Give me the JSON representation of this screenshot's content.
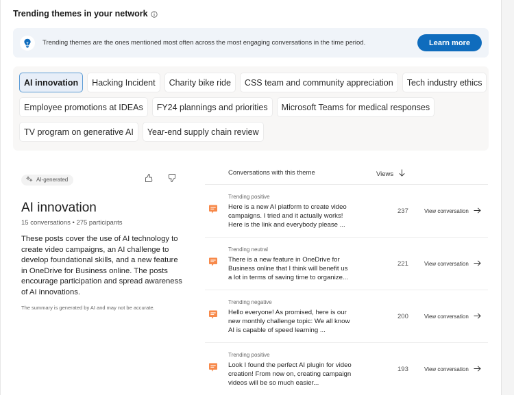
{
  "header": {
    "title": "Trending themes in your network",
    "info_icon": "info-icon"
  },
  "banner": {
    "icon": "lightbulb-icon",
    "text": "Trending themes are the ones mentioned most often across the most engaging conversations in the time period.",
    "button_label": "Learn more",
    "accent": "#0f6cbd"
  },
  "themes": {
    "rows": [
      [
        {
          "label": "AI innovation",
          "selected": true
        },
        {
          "label": "Hacking Incident"
        },
        {
          "label": "Charity bike ride"
        },
        {
          "label": "CSS team and community appreciation"
        },
        {
          "label": "Tech industry ethics"
        }
      ],
      [
        {
          "label": "Employee promotions at IDEAs"
        },
        {
          "label": "FY24 plannings and priorities"
        },
        {
          "label": "Microsoft Teams for medical responses"
        }
      ],
      [
        {
          "label": "TV program on generative AI"
        },
        {
          "label": "Year-end supply chain review"
        }
      ]
    ]
  },
  "detail": {
    "badge": "AI-generated",
    "badge_icon": "sparkle-icon",
    "thumbs_up_icon": "thumbs-up-icon",
    "thumbs_down_icon": "thumbs-down-icon",
    "title": "AI innovation",
    "conversations": "15 conversations",
    "separator": "•",
    "participants": "275 participants",
    "summary": "These posts cover the use of AI technology to create video campaigns, an AI challenge to develop foundational skills, and a new feature in OneDrive for Business online. The posts encourage participation and spread awareness of AI innovations.",
    "disclaimer": "The summary is generated by AI and may not be accurate."
  },
  "conversations": {
    "header_title": "Conversations with this theme",
    "header_views": "Views",
    "sort_icon": "arrow-down-icon",
    "link_label": "View conversation",
    "icon_color": "#f7894a",
    "rows": [
      {
        "status": "Trending positive",
        "text": "Here is a new AI platform to create video campaigns. I tried and it actually works! Here is the link and everybody please ...",
        "views": "237"
      },
      {
        "status": "Trending neutral",
        "text": "There is a new feature in OneDrive for Business online that I think will benefit us a lot in terms of saving time to organize...",
        "views": "221"
      },
      {
        "status": "Trending negative",
        "text": "Hello everyone! As promised, here is our new monthly challenge topic: We all know AI is capable of speed learning ...",
        "views": "200"
      },
      {
        "status": "Trending positive",
        "text": "Look I found the perfect AI plugin for video creation! From now on, creating campaign videos will be so much easier...",
        "views": "193"
      }
    ]
  }
}
